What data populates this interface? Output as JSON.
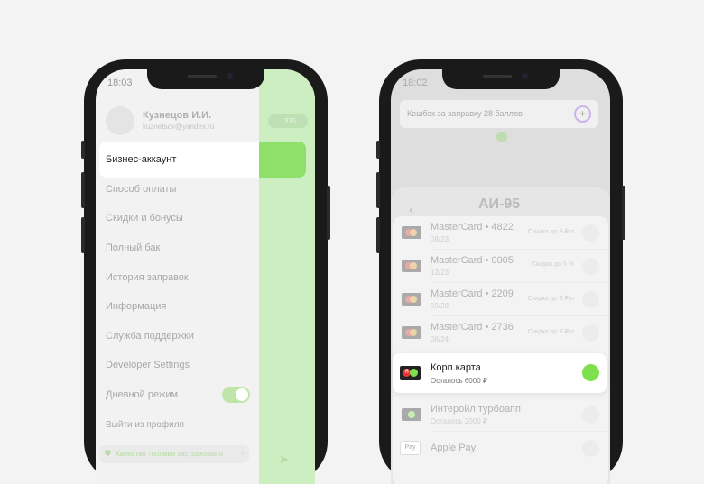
{
  "left": {
    "status_time": "18:03",
    "profile": {
      "name": "Кузнецов И.И.",
      "email": "kuznetsov@yandex.ru"
    },
    "points_badge": "315",
    "menu": [
      "Бизнес-аккаунт",
      "Способ оплаты",
      "Скидки и бонусы",
      "Полный бак",
      "История заправок",
      "Информация",
      "Служба поддержки",
      "Developer Settings",
      "Дневной режим"
    ],
    "day_mode_on": true,
    "logout": "Выйти из профиля",
    "quality": "Качество топлива застраховано"
  },
  "right": {
    "status_time": "18:02",
    "cashback": "Кешбэк за заправку 28 баллов",
    "fuel_title": "АИ-95",
    "cards": [
      {
        "title": "MasterCard • 4822",
        "sub": "08/23",
        "discount": "Скидка до 3 ₽/л"
      },
      {
        "title": "MasterCard • 0005",
        "sub": "12/23",
        "discount": "Скидка до 5 %"
      },
      {
        "title": "MasterCard • 2209",
        "sub": "09/28",
        "discount": "Скидка до 3 ₽/л"
      },
      {
        "title": "MasterCard • 2736",
        "sub": "08/24",
        "discount": "Скидка до 3 ₽/л"
      }
    ],
    "selected": {
      "title": "Корп.карта",
      "sub": "Осталось 6000 ₽",
      "logo": "Я"
    },
    "interoil": {
      "title": "Интеройл турбоапп",
      "sub": "Осталось 2000 ₽"
    },
    "applepay": {
      "title": "Apple Pay",
      "logo": "Pay"
    }
  },
  "colors": {
    "accent": "#7ee04c",
    "map": "#cdeec0"
  }
}
